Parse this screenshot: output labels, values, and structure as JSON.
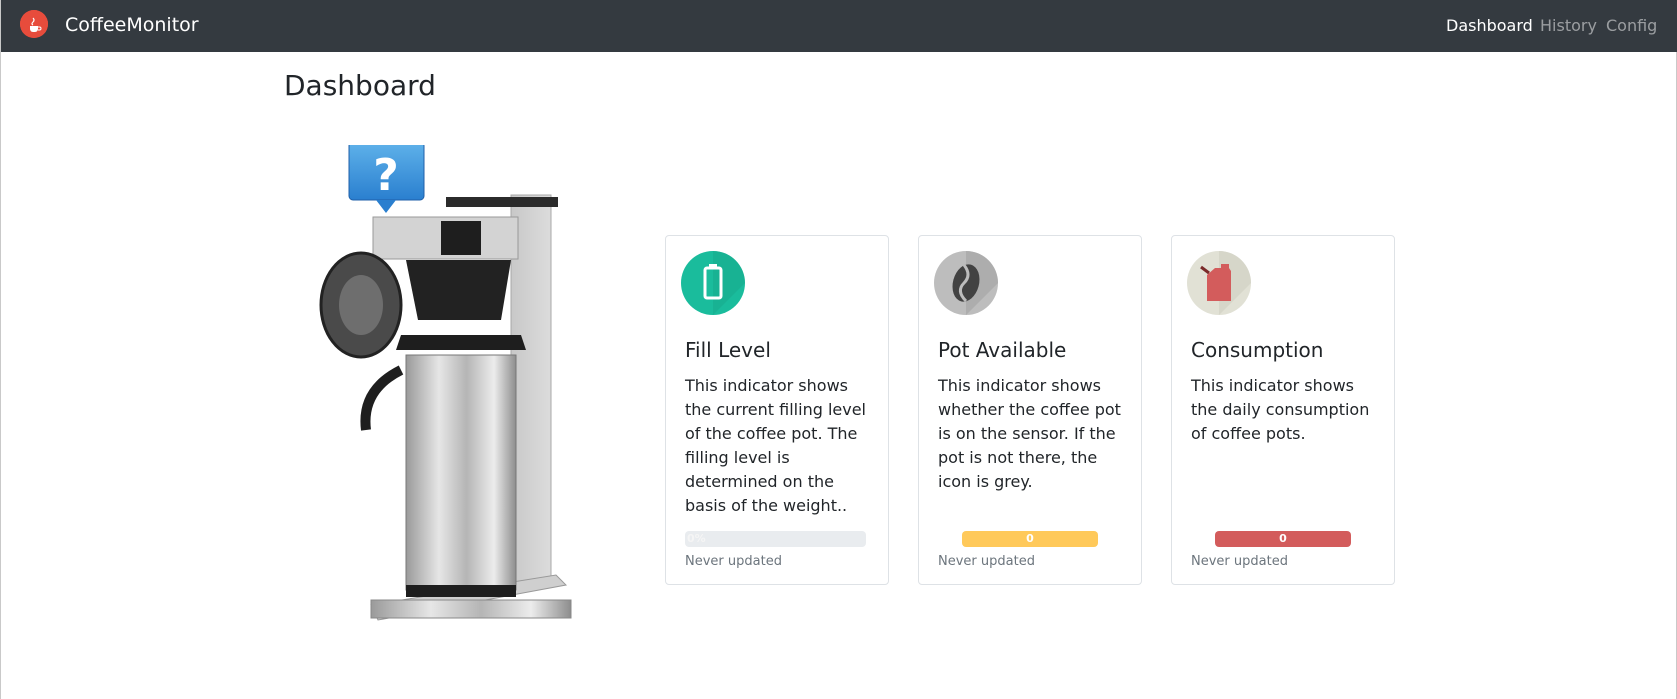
{
  "app": {
    "name": "CoffeeMonitor",
    "brand_color": "#e74c3c",
    "navbar_color": "#343a40"
  },
  "nav": {
    "items": [
      {
        "label": "Dashboard",
        "active": true
      },
      {
        "label": "History",
        "active": false
      },
      {
        "label": "Config",
        "active": false
      }
    ]
  },
  "page": {
    "title": "Dashboard"
  },
  "cards": [
    {
      "title": "Fill Level",
      "icon": "battery-icon",
      "icon_color": "#1abc9c",
      "text": "This indicator shows the current filling level of the coffee pot. The filling level is determined on the basis of the weight..",
      "progress_label": "0%",
      "progress_value": 0,
      "progress_color": "#e9ecef",
      "updated": "Never updated"
    },
    {
      "title": "Pot Available",
      "icon": "coffee-bean-icon",
      "icon_color": "#bdbdbd",
      "text": "This indicator shows whether the coffee pot is on the sensor. If the pot is not there, the icon is grey.",
      "progress_label": "0",
      "progress_value": 1,
      "progress_color": "#ffc95a",
      "updated": "Never updated"
    },
    {
      "title": "Consumption",
      "icon": "fuel-can-icon",
      "icon_color": "#e1e1d5",
      "text": "This indicator shows the daily consumption of coffee pots.",
      "progress_label": "0",
      "progress_value": 1,
      "progress_color": "#d35c5c",
      "updated": "Never updated"
    }
  ]
}
